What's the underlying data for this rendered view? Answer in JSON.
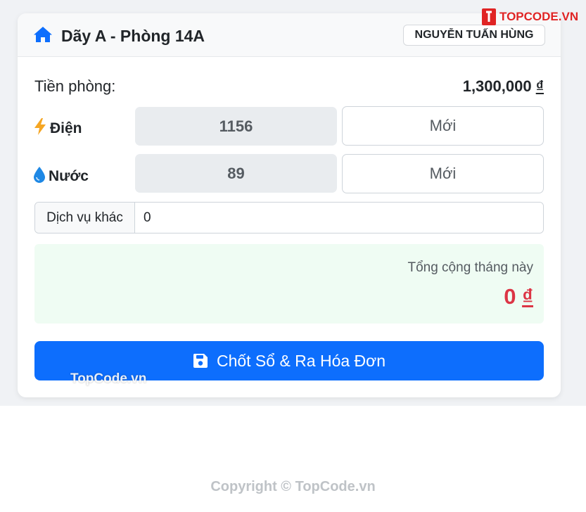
{
  "header": {
    "room_title": "Dãy A - Phòng 14A",
    "tenant_name": "NGUYỄN TUẤN HÙNG"
  },
  "rent": {
    "label": "Tiền phòng:",
    "amount": "1,300,000",
    "currency": "₫"
  },
  "electric": {
    "icon": "lightning-icon",
    "label": "Điện",
    "old_reading": "1156",
    "new_placeholder": "Mới"
  },
  "water": {
    "icon": "water-drop-icon",
    "label": "Nước",
    "old_reading": "89",
    "new_placeholder": "Mới"
  },
  "services": {
    "label": "Dịch vụ khác",
    "value": "0"
  },
  "total": {
    "label": "Tổng cộng tháng này",
    "amount": "0",
    "currency": "₫"
  },
  "submit": {
    "icon": "floppy-disk-icon",
    "label": "Chốt Sổ & Ra Hóa Đơn"
  },
  "watermarks": {
    "brand": "TOPCODE.VN",
    "mid": "TopCode.vn",
    "copyright": "Copyright © TopCode.vn"
  },
  "colors": {
    "primary": "#0d6efd",
    "danger": "#dc3545",
    "total_bg": "#effcf3",
    "lightning": "#f5a623",
    "water": "#1e88e5"
  }
}
